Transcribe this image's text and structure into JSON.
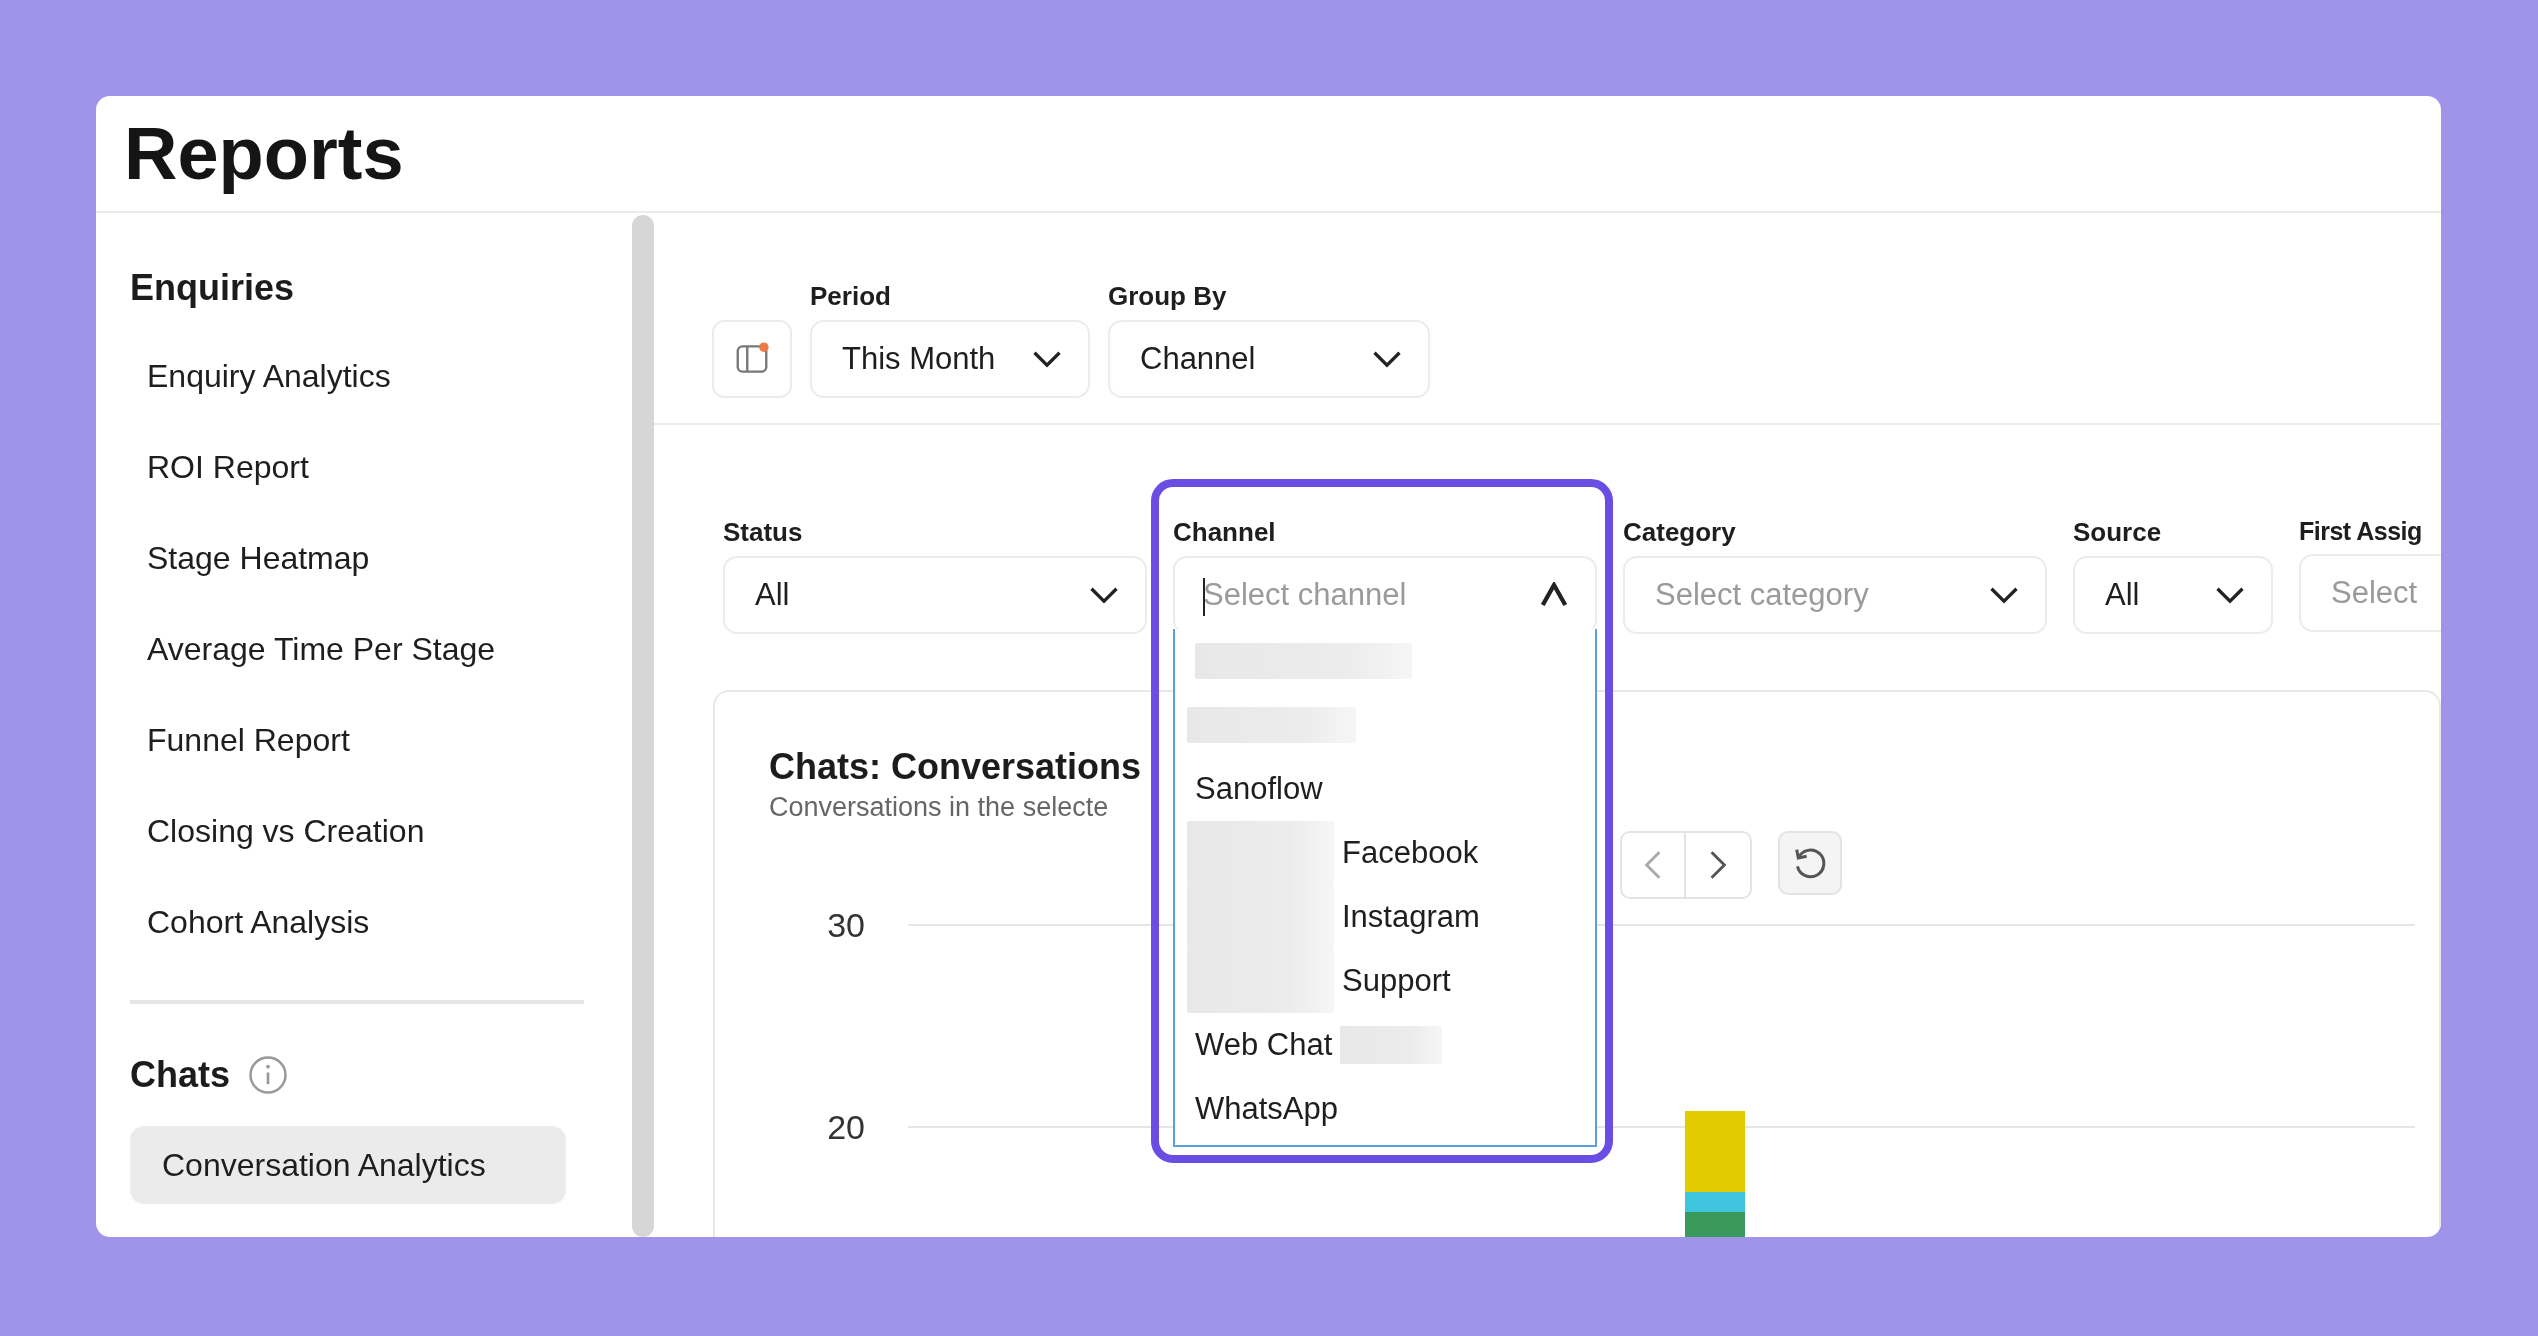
{
  "header": {
    "title": "Reports"
  },
  "sidebar": {
    "sections": [
      {
        "title": "Enquiries",
        "info": false,
        "items": [
          {
            "label": "Enquiry Analytics",
            "selected": false
          },
          {
            "label": "ROI Report",
            "selected": false
          },
          {
            "label": "Stage Heatmap",
            "selected": false
          },
          {
            "label": "Average Time Per Stage",
            "selected": false
          },
          {
            "label": "Funnel Report",
            "selected": false
          },
          {
            "label": "Closing vs Creation",
            "selected": false
          },
          {
            "label": "Cohort Analysis",
            "selected": false
          }
        ]
      },
      {
        "title": "Chats",
        "info": true,
        "items": [
          {
            "label": "Conversation Analytics",
            "selected": true
          }
        ]
      }
    ]
  },
  "toolbar": {
    "notification": true,
    "selects": [
      {
        "label": "Period",
        "value": "This Month"
      },
      {
        "label": "Group By",
        "value": "Channel"
      }
    ]
  },
  "filters": [
    {
      "label": "Status",
      "value": "All",
      "open": false
    },
    {
      "label": "Channel",
      "placeholder": "Select channel",
      "open": true,
      "highlighted": true
    },
    {
      "label": "Category",
      "placeholder": "Select category",
      "open": false
    },
    {
      "label": "Source",
      "value": "All",
      "open": false
    },
    {
      "label": "First Assig",
      "placeholder": "Select",
      "open": false
    }
  ],
  "channel_options": [
    {
      "kind": "redacted"
    },
    {
      "kind": "redacted"
    },
    {
      "kind": "option",
      "label": "Sanoflow"
    },
    {
      "kind": "redacted_before",
      "label": "Facebook"
    },
    {
      "kind": "redacted_before",
      "label": "Instagram"
    },
    {
      "kind": "redacted_before",
      "label": "Support"
    },
    {
      "kind": "redacted_after",
      "label": "Web Chat"
    },
    {
      "kind": "option",
      "label": "WhatsApp"
    }
  ],
  "chart": {
    "title": "Chats: Conversations",
    "subtitle": "Conversations in the selecte",
    "y_ticks": [
      "30",
      "20"
    ]
  }
}
